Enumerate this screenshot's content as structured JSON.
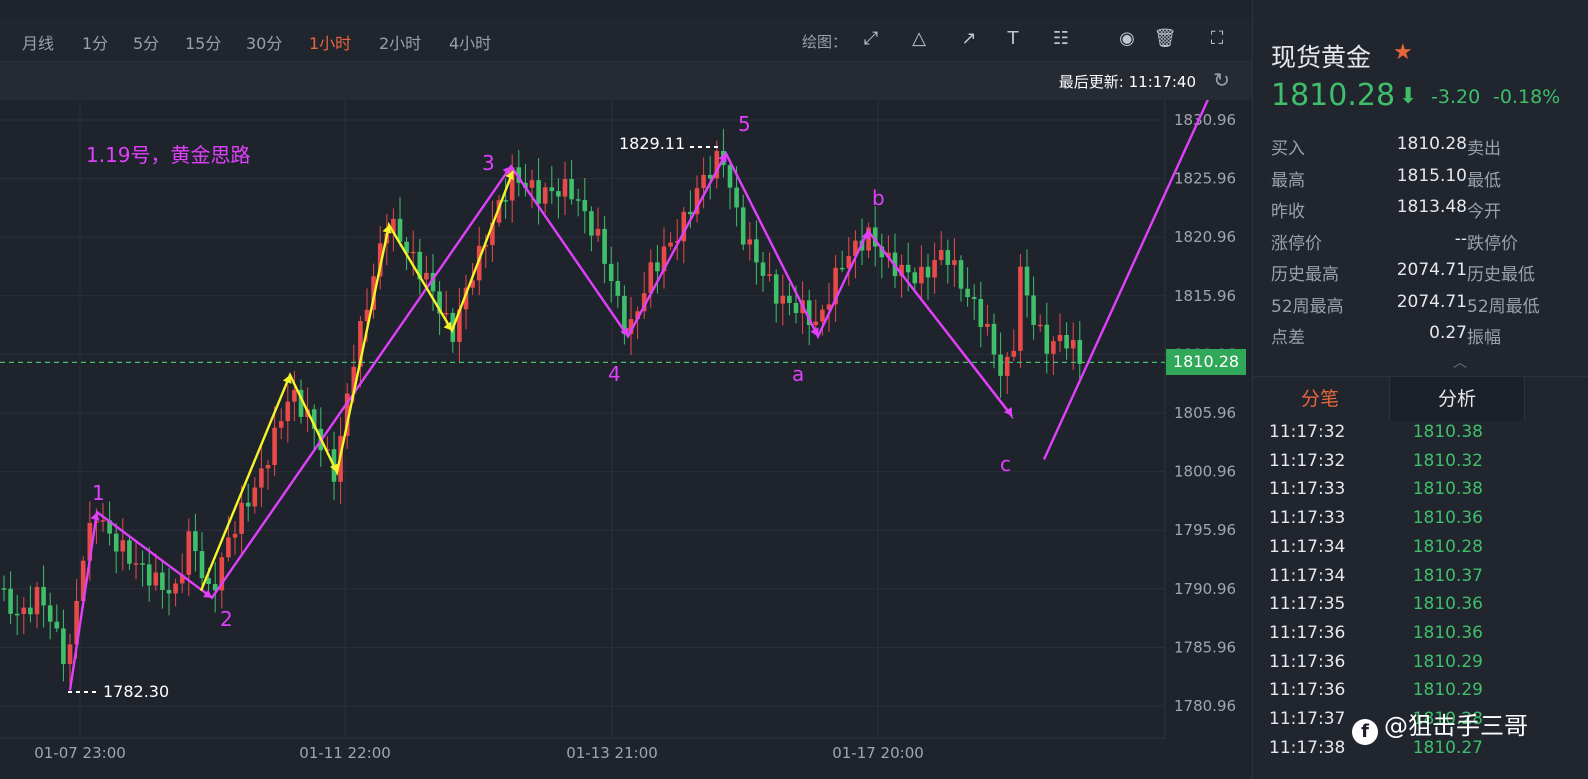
{
  "toolbar": {
    "periods": [
      "月线",
      "1分",
      "5分",
      "15分",
      "30分",
      "1小时",
      "2小时",
      "4小时"
    ],
    "active_period": "1小时",
    "draw_label": "绘图："
  },
  "update": {
    "text": "最后更新: 11:17:40"
  },
  "chart_data": {
    "type": "candlestick",
    "title": "1.19号，黄金思路",
    "y_ticks": [
      "1830.96",
      "1825.96",
      "1820.96",
      "1815.96",
      "1810.96",
      "1805.96",
      "1800.96",
      "1795.96",
      "1790.96",
      "1785.96",
      "1780.96"
    ],
    "x_ticks": [
      "01-07 23:00",
      "01-11 22:00",
      "01-13 21:00",
      "01-17 20:00"
    ],
    "current_price": "1810.28",
    "annotations": {
      "high_label": "1829.11",
      "low_label": "1782.30",
      "wave_labels": [
        "1",
        "2",
        "3",
        "4",
        "5",
        "a",
        "b",
        "c"
      ]
    },
    "colors": {
      "up": "#e84a4a",
      "down": "#3fbf6a",
      "magenta": "#e040fb",
      "yellow": "#f5f52a"
    }
  },
  "instrument": {
    "name": "现货黄金",
    "price": "1810.28",
    "change": "-3.20",
    "change_pct": "-0.18%"
  },
  "quote": [
    {
      "label": "买入",
      "value": "1810.28",
      "label2": "卖出"
    },
    {
      "label": "最高",
      "value": "1815.10",
      "label2": "最低"
    },
    {
      "label": "昨收",
      "value": "1813.48",
      "label2": "今开"
    },
    {
      "label": "涨停价",
      "value": "--",
      "label2": "跌停价"
    },
    {
      "label": "历史最高",
      "value": "2074.71",
      "label2": "历史最低"
    },
    {
      "label": "52周最高",
      "value": "2074.71",
      "label2": "52周最低"
    },
    {
      "label": "点差",
      "value": "0.27",
      "label2": "振幅"
    }
  ],
  "tabs": {
    "ticks": "分笔",
    "analysis": "分析"
  },
  "ticks": [
    {
      "time": "11:17:32",
      "price": "1810.38"
    },
    {
      "time": "11:17:32",
      "price": "1810.32"
    },
    {
      "time": "11:17:33",
      "price": "1810.38"
    },
    {
      "time": "11:17:33",
      "price": "1810.36"
    },
    {
      "time": "11:17:34",
      "price": "1810.28"
    },
    {
      "time": "11:17:34",
      "price": "1810.37"
    },
    {
      "time": "11:17:35",
      "price": "1810.36"
    },
    {
      "time": "11:17:36",
      "price": "1810.36"
    },
    {
      "time": "11:17:36",
      "price": "1810.29"
    },
    {
      "time": "11:17:36",
      "price": "1810.29"
    },
    {
      "time": "11:17:37",
      "price": "1810.28"
    },
    {
      "time": "11:17:38",
      "price": "1810.27"
    }
  ],
  "watermark": "@狙击手三哥"
}
